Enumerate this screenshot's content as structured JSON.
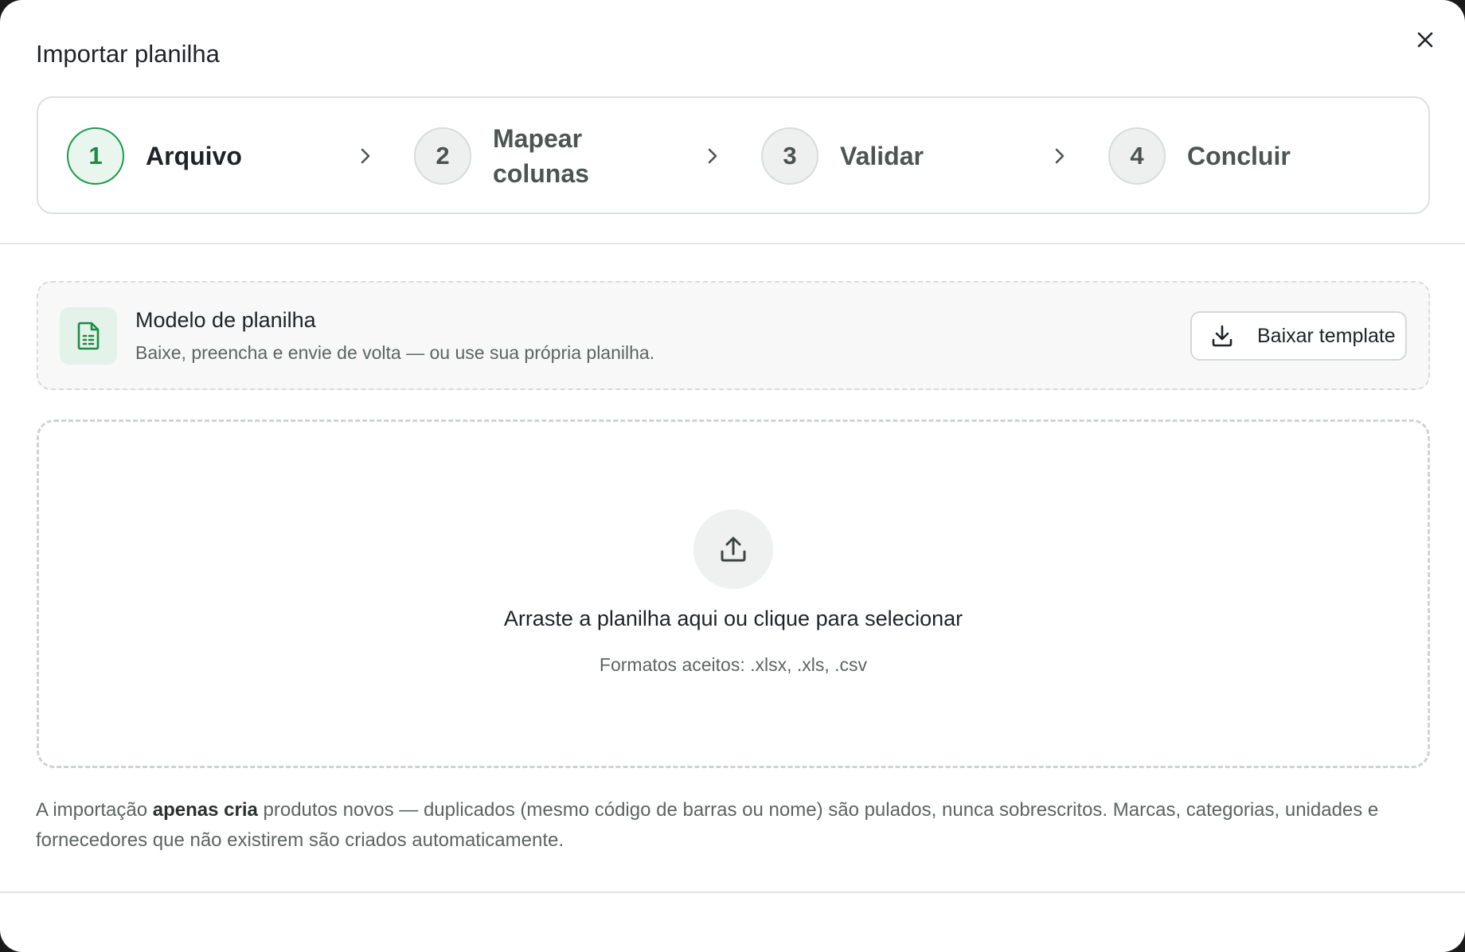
{
  "dialog": {
    "title": "Importar planilha"
  },
  "stepper": {
    "steps": [
      {
        "number": "1",
        "label": "Arquivo",
        "state": "active"
      },
      {
        "number": "2",
        "label_line1": "Mapear",
        "label_line2": "colunas",
        "state": "pending"
      },
      {
        "number": "3",
        "label": "Validar",
        "state": "pending"
      },
      {
        "number": "4",
        "label": "Concluir",
        "state": "pending"
      }
    ]
  },
  "template": {
    "title": "Modelo de planilha",
    "description": "Baixe, preencha e envie de volta — ou use sua própria planilha.",
    "download_label": "Baixar template",
    "icon": "file-spreadsheet-icon"
  },
  "dropzone": {
    "title": "Arraste a planilha aqui ou clique para selecionar",
    "formats": "Formatos aceitos: .xlsx, .xls, .csv",
    "icon": "upload-icon"
  },
  "note": {
    "prefix": "A importação ",
    "emphasis": "apenas cria",
    "suffix": " produtos novos — duplicados (mesmo código de barras ou nome) são pulados, nunca sobrescritos. Marcas, categorias, unidades e fornecedores que não existirem são criados automaticamente."
  },
  "colors": {
    "accent": "#1e9a4f",
    "accent_bg": "#e8f6ee"
  }
}
